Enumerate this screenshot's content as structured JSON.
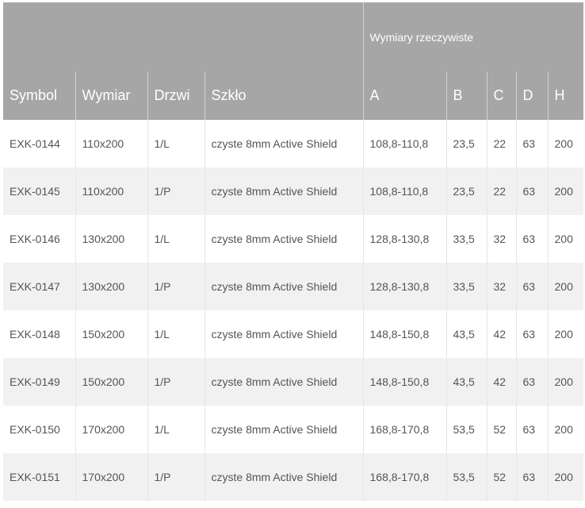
{
  "table": {
    "group_header": "Wymiary rzeczywiste",
    "columns": [
      "Symbol",
      "Wymiar",
      "Drzwi",
      "Szkło",
      "A",
      "B",
      "C",
      "D",
      "H"
    ],
    "rows": [
      [
        "EXK-0144",
        "110x200",
        "1/L",
        "czyste 8mm Active Shield",
        "108,8-110,8",
        "23,5",
        "22",
        "63",
        "200"
      ],
      [
        "EXK-0145",
        "110x200",
        "1/P",
        "czyste 8mm Active Shield",
        "108,8-110,8",
        "23,5",
        "22",
        "63",
        "200"
      ],
      [
        "EXK-0146",
        "130x200",
        "1/L",
        "czyste 8mm Active Shield",
        "128,8-130,8",
        "33,5",
        "32",
        "63",
        "200"
      ],
      [
        "EXK-0147",
        "130x200",
        "1/P",
        "czyste 8mm Active Shield",
        "128,8-130,8",
        "33,5",
        "32",
        "63",
        "200"
      ],
      [
        "EXK-0148",
        "150x200",
        "1/L",
        "czyste 8mm Active Shield",
        "148,8-150,8",
        "43,5",
        "42",
        "63",
        "200"
      ],
      [
        "EXK-0149",
        "150x200",
        "1/P",
        "czyste 8mm Active Shield",
        "148,8-150,8",
        "43,5",
        "42",
        "63",
        "200"
      ],
      [
        "EXK-0150",
        "170x200",
        "1/L",
        "czyste 8mm Active Shield",
        "168,8-170,8",
        "53,5",
        "52",
        "63",
        "200"
      ],
      [
        "EXK-0151",
        "170x200",
        "1/P",
        "czyste 8mm Active Shield",
        "168,8-170,8",
        "53,5",
        "52",
        "63",
        "200"
      ]
    ],
    "colors": {
      "header_bg": "#a6a6a6",
      "header_text": "#ffffff",
      "row_alt_bg": "#f1f1f1",
      "cell_text": "#555555"
    }
  }
}
